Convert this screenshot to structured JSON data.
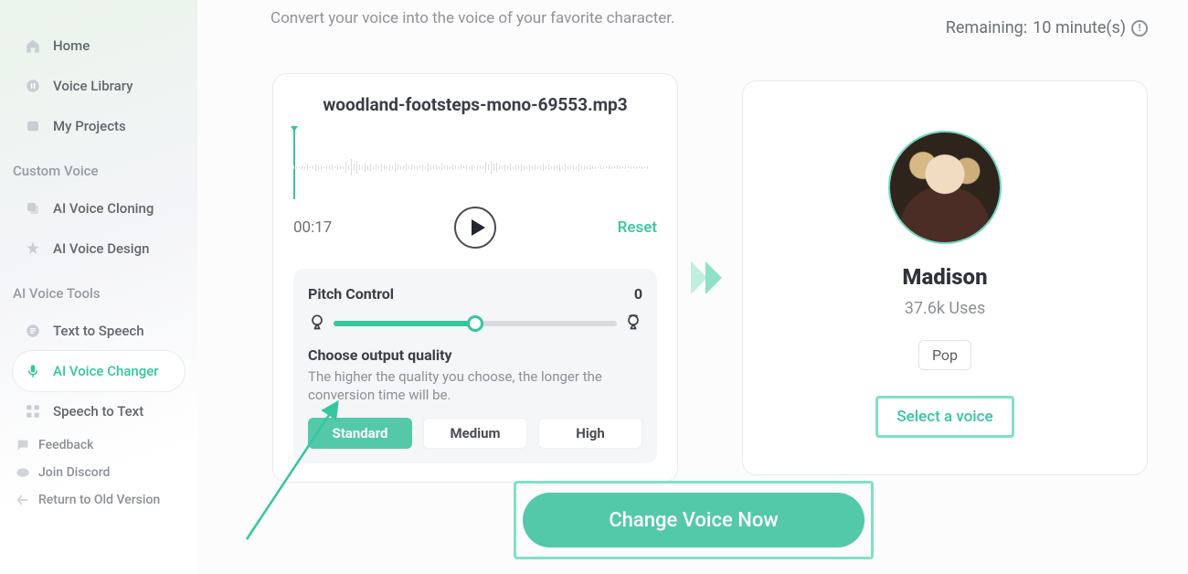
{
  "sidebar": {
    "primary": [
      {
        "label": "Home",
        "icon": "home-icon"
      },
      {
        "label": "Voice Library",
        "icon": "library-icon"
      },
      {
        "label": "My Projects",
        "icon": "projects-icon"
      }
    ],
    "section1": "Custom Voice",
    "custom": [
      {
        "label": "AI Voice Cloning",
        "icon": "clone-icon"
      },
      {
        "label": "AI Voice Design",
        "icon": "design-icon"
      }
    ],
    "section2": "AI Voice Tools",
    "tools": [
      {
        "label": "Text to Speech",
        "icon": "tts-icon"
      },
      {
        "label": "AI Voice Changer",
        "icon": "mic-icon",
        "active": true
      },
      {
        "label": "Speech to Text",
        "icon": "stt-icon"
      }
    ],
    "footer": [
      {
        "label": "Feedback",
        "icon": "feedback-icon"
      },
      {
        "label": "Join Discord",
        "icon": "discord-icon"
      },
      {
        "label": "Return to Old Version",
        "icon": "return-icon"
      }
    ]
  },
  "header": {
    "subtitle": "Convert your voice into the voice of your favorite character.",
    "remaining_prefix": "Remaining: ",
    "remaining_value": "10 minute(s)"
  },
  "source": {
    "filename": "woodland-footsteps-mono-69553.mp3",
    "time": "00:17",
    "reset": "Reset",
    "pitch_title": "Pitch Control",
    "pitch_value": "0",
    "oq_title": "Choose output quality",
    "oq_desc": "The higher the quality you choose, the longer the conversion time will be.",
    "quality": [
      "Standard",
      "Medium",
      "High"
    ]
  },
  "voice": {
    "name": "Madison",
    "uses": "37.6k Uses",
    "tag": "Pop",
    "select": "Select a voice"
  },
  "cta": "Change Voice Now"
}
